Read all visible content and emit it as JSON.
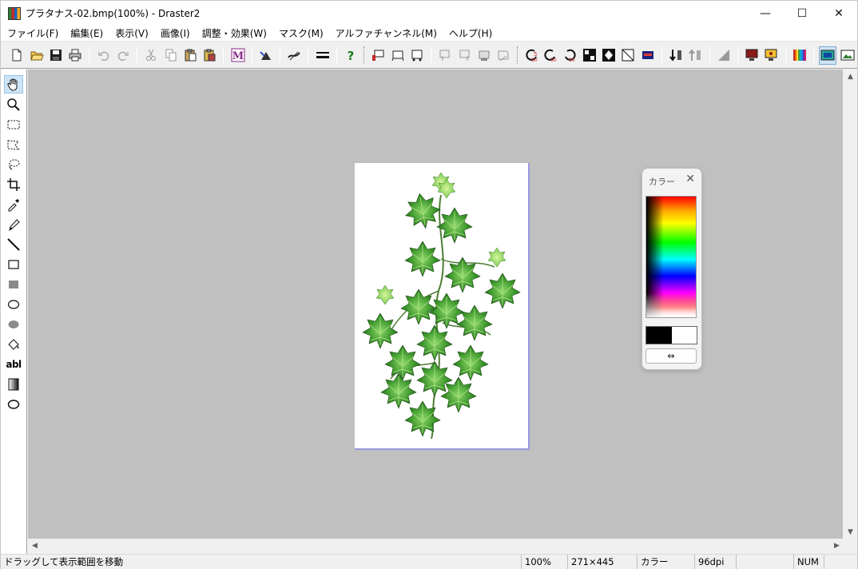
{
  "window": {
    "title": "プラタナス-02.bmp(100%) - Draster2",
    "min_glyph": "—",
    "max_glyph": "☐",
    "close_glyph": "✕"
  },
  "menu": [
    "ファイル(F)",
    "編集(E)",
    "表示(V)",
    "画像(I)",
    "調整・効果(W)",
    "マスク(M)",
    "アルファチャンネル(M)",
    "ヘルプ(H)"
  ],
  "tools": {
    "text_tool_label": "abl"
  },
  "color_panel": {
    "title": "カラー",
    "close_glyph": "✕",
    "swap_glyph": "⇔",
    "foreground": "#000000",
    "background": "#ffffff"
  },
  "status": {
    "message": "ドラッグして表示範囲を移動",
    "zoom": "100%",
    "size": "271×445",
    "mode": "カラー",
    "dpi": "96dpi",
    "num": "NUM"
  },
  "toolbar": {
    "mask_letter": "M",
    "help_glyph": "?"
  }
}
